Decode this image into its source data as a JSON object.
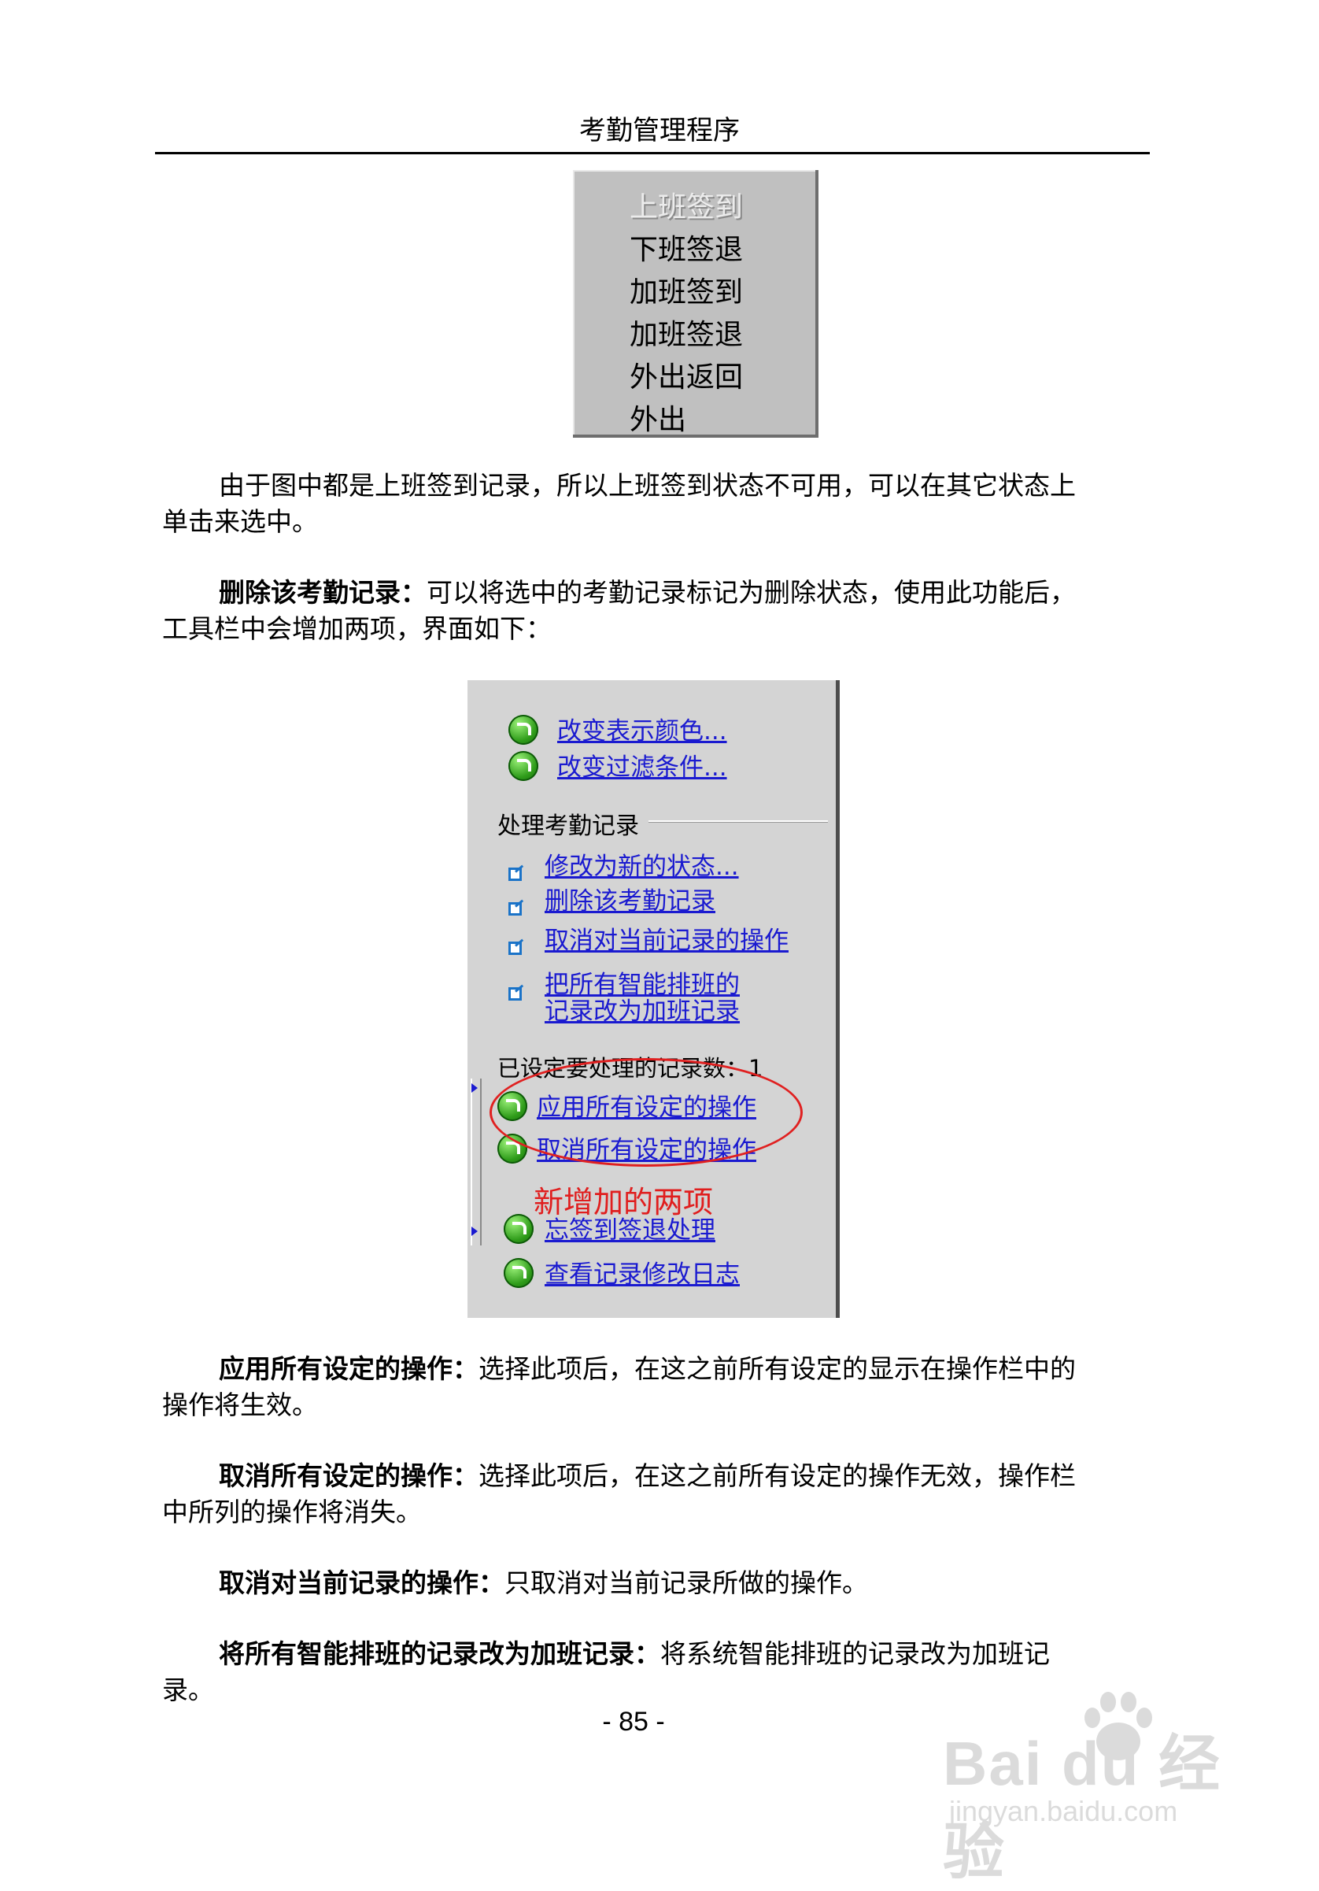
{
  "header": {
    "title": "考勤管理程序"
  },
  "status_menu": {
    "items": [
      {
        "label": "上班签到",
        "disabled": true
      },
      {
        "label": "下班签退",
        "disabled": false
      },
      {
        "label": "加班签到",
        "disabled": false
      },
      {
        "label": "加班签退",
        "disabled": false
      },
      {
        "label": "外出返回",
        "disabled": false
      },
      {
        "label": "外出",
        "disabled": false
      }
    ]
  },
  "paragraphs": {
    "p1_line1": "由于图中都是上班签到记录，所以上班签到状态不可用，可以在其它状态上",
    "p1_line2": "单击来选中。",
    "p2_term": "删除该考勤记录：",
    "p2_line1_rest": "可以将选中的考勤记录标记为删除状态，使用此功能后，",
    "p2_line2": "工具栏中会增加两项，界面如下：",
    "p3_term": "应用所有设定的操作：",
    "p3_line1_rest": "选择此项后，在这之前所有设定的显示在操作栏中的",
    "p3_line2": "操作将生效。",
    "p4_term": "取消所有设定的操作：",
    "p4_line1_rest": "选择此项后，在这之前所有设定的操作无效，操作栏",
    "p4_line2": "中所列的操作将消失。",
    "p5_term": "取消对当前记录的操作：",
    "p5_rest": "只取消对当前记录所做的操作。",
    "p6_term": "将所有智能排班的记录改为加班记录：",
    "p6_line1_rest": "将系统智能排班的记录改为加班记",
    "p6_line2": "录。"
  },
  "panel": {
    "top_links": [
      "改变表示颜色...",
      "改变过滤条件..."
    ],
    "section_title": "处理考勤记录",
    "record_links": [
      "修改为新的状态...",
      "删除该考勤记录",
      "取消对当前记录的操作"
    ],
    "smart_link_line1": "把所有智能排班的",
    "smart_link_line2": "记录改为加班记录",
    "count_label": "已设定要处理的记录数：1",
    "new_links": [
      "应用所有设定的操作",
      "取消所有设定的操作"
    ],
    "annotation": "新增加的两项",
    "bottom_links": [
      "忘签到签退处理",
      "查看记录修改日志"
    ],
    "colors": {
      "link": "#1a1ad0",
      "annotation": "#e01e1e",
      "panel_bg": "#d4d4d4"
    }
  },
  "footer": {
    "page_number": "- 85 -"
  },
  "watermark": {
    "logo": "Bai du 经验",
    "url": "jingyan.baidu.com"
  }
}
